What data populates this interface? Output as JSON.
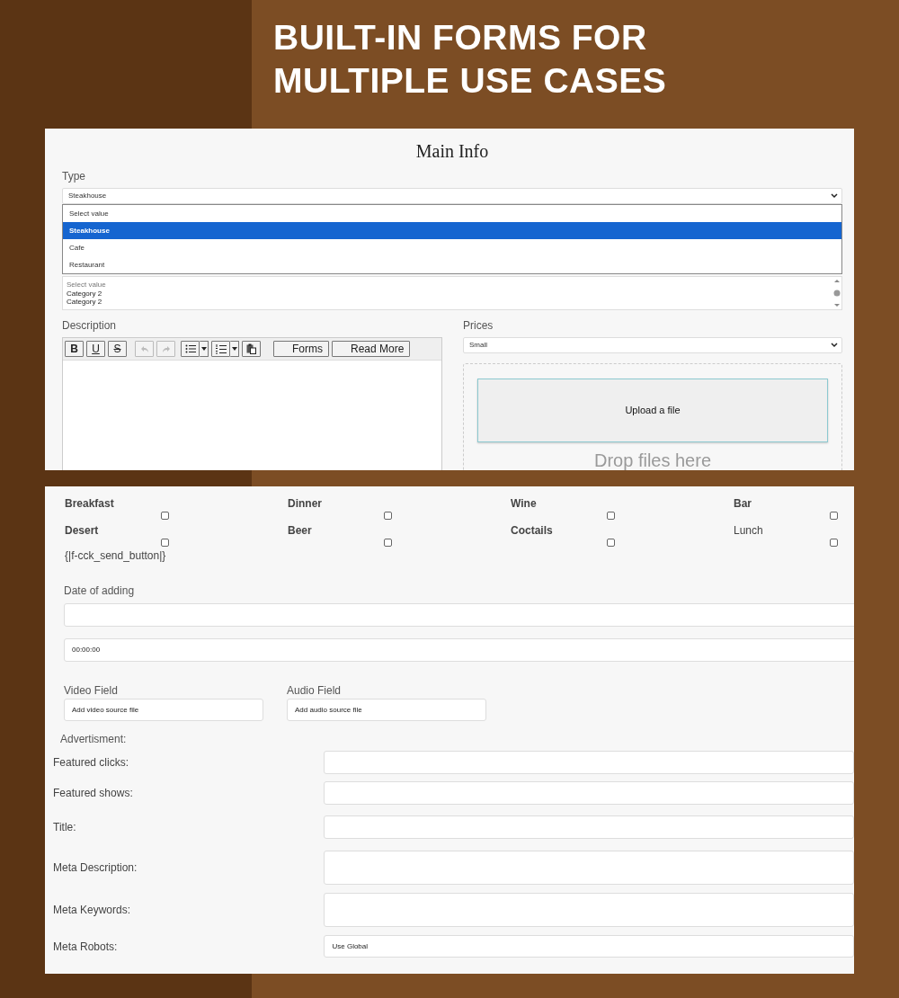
{
  "header": {
    "title_lines": [
      "BUILT-IN FORMS FOR",
      "MULTIPLE USE CASES"
    ]
  },
  "main_info": {
    "title": "Main Info",
    "type_field": {
      "label": "Type",
      "value": "Steakhouse",
      "options": [
        {
          "label": "Select value",
          "selected": false
        },
        {
          "label": "Steakhouse",
          "selected": true
        },
        {
          "label": "Cafe",
          "selected": false
        },
        {
          "label": "Restaurant",
          "selected": false
        }
      ]
    },
    "category_list": [
      {
        "text": "Select value",
        "kind": "placeholder"
      },
      {
        "text": "Category 2",
        "kind": "option"
      },
      {
        "text": "Category 2",
        "kind": "option"
      }
    ],
    "description": {
      "label": "Description",
      "toolbar": [
        {
          "kind": "bold",
          "label": "B",
          "disabled": false
        },
        {
          "kind": "underline",
          "label": "U",
          "disabled": false
        },
        {
          "kind": "strike",
          "label": "S",
          "disabled": false
        },
        {
          "kind": "undo",
          "disabled": true
        },
        {
          "kind": "redo",
          "disabled": true
        },
        {
          "kind": "bullets",
          "disabled": false
        },
        {
          "kind": "numbers",
          "disabled": false
        },
        {
          "kind": "paste",
          "disabled": false
        },
        {
          "kind": "button",
          "label": "Forms",
          "disabled": false
        },
        {
          "kind": "button",
          "label": "Read More",
          "disabled": false
        }
      ]
    },
    "prices": {
      "label": "Prices",
      "value": "Small",
      "upload_button": "Upload a file",
      "drop_hint": "Drop files here"
    }
  },
  "extras": {
    "checkboxes": [
      {
        "label": "Breakfast",
        "bold": true,
        "checked": false
      },
      {
        "label": "Dinner",
        "bold": true,
        "checked": false
      },
      {
        "label": "Wine",
        "bold": true,
        "checked": false
      },
      {
        "label": "Bar",
        "bold": true,
        "checked": false
      },
      {
        "label": "Desert",
        "bold": true,
        "checked": false
      },
      {
        "label": "Beer",
        "bold": true,
        "checked": false
      },
      {
        "label": "Coctails",
        "bold": true,
        "checked": false
      },
      {
        "label": "Lunch",
        "bold": false,
        "checked": false
      }
    ],
    "send_placeholder": "{|f-cck_send_button|}",
    "date": {
      "label": "Date of adding",
      "time": "00:00:00"
    },
    "media": [
      {
        "label": "Video Field",
        "value": "Add video source file"
      },
      {
        "label": "Audio Field",
        "value": "Add audio source file"
      }
    ],
    "advertisment": "Advertisment:",
    "meta_fields": [
      {
        "label": "Featured clicks:",
        "kind": "input"
      },
      {
        "label": "Featured shows:",
        "kind": "input"
      },
      {
        "label": "Title:",
        "kind": "input"
      },
      {
        "label": "Meta Description:",
        "kind": "textarea"
      },
      {
        "label": "Meta Keywords:",
        "kind": "textarea"
      },
      {
        "label": "Meta Robots:",
        "kind": "select",
        "value": "Use Global"
      }
    ]
  }
}
